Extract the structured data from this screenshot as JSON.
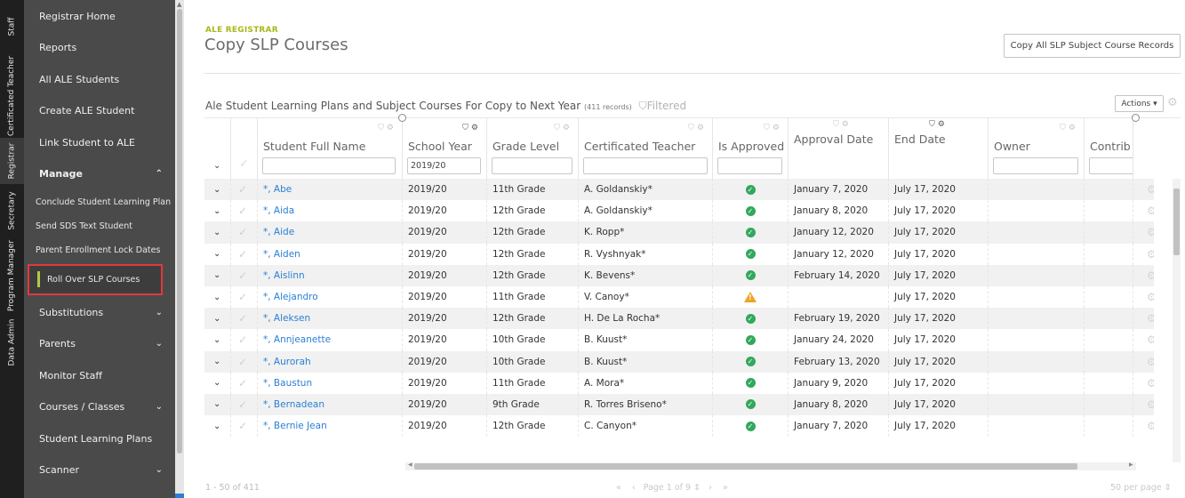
{
  "rail_tabs": [
    "Staff",
    "Certificated Teacher",
    "Registrar",
    "Secretary",
    "Program Manager",
    "Data Admin"
  ],
  "sidebar": {
    "items": [
      {
        "label": "Registrar Home"
      },
      {
        "label": "Reports"
      },
      {
        "label": "All ALE Students"
      },
      {
        "label": "Create ALE Student"
      },
      {
        "label": "Link Student to ALE"
      }
    ],
    "manage": {
      "label": "Manage",
      "subitems": [
        "Conclude Student Learning Plan",
        "Send SDS Text Student",
        "Parent Enrollment Lock Dates",
        "Roll Over SLP Courses"
      ]
    },
    "after": [
      {
        "label": "Substitutions",
        "expandable": true
      },
      {
        "label": "Parents",
        "expandable": true
      },
      {
        "label": "Monitor Staff",
        "expandable": false
      },
      {
        "label": "Courses / Classes",
        "expandable": true
      },
      {
        "label": "Student Learning Plans",
        "expandable": false
      },
      {
        "label": "Scanner",
        "expandable": true
      }
    ]
  },
  "header": {
    "eyebrow": "ALE REGISTRAR",
    "title": "Copy SLP Courses",
    "copy_button": "Copy All SLP Subject Course Records"
  },
  "grid": {
    "title": "Ale Student Learning Plans and Subject Courses For Copy to Next Year",
    "count": "(411 records)",
    "filtered": "Filtered",
    "actions_label": "Actions ▾",
    "columns": {
      "name": "Student Full Name",
      "year": "School Year",
      "grade": "Grade Level",
      "teacher": "Certificated Teacher",
      "approved": "Is Approved",
      "approval_date": "Approval Date",
      "end_date": "End Date",
      "owner": "Owner",
      "contrib": "Contrib"
    },
    "filters": {
      "year": "2019/20"
    },
    "rows": [
      {
        "name": "*, Abe",
        "year": "2019/20",
        "grade": "11th Grade",
        "teacher": "A. Goldanskiy*",
        "approved": "ok",
        "approval_date": "January 7, 2020",
        "end_date": "July 17, 2020"
      },
      {
        "name": "*, Aida",
        "year": "2019/20",
        "grade": "12th Grade",
        "teacher": "A. Goldanskiy*",
        "approved": "ok",
        "approval_date": "January 8, 2020",
        "end_date": "July 17, 2020"
      },
      {
        "name": "*, Aide",
        "year": "2019/20",
        "grade": "12th Grade",
        "teacher": "K. Ropp*",
        "approved": "ok",
        "approval_date": "January 12, 2020",
        "end_date": "July 17, 2020"
      },
      {
        "name": "*, Aiden",
        "year": "2019/20",
        "grade": "12th Grade",
        "teacher": "R. Vyshnyak*",
        "approved": "ok",
        "approval_date": "January 12, 2020",
        "end_date": "July 17, 2020"
      },
      {
        "name": "*, Aislinn",
        "year": "2019/20",
        "grade": "12th Grade",
        "teacher": "K. Bevens*",
        "approved": "ok",
        "approval_date": "February 14, 2020",
        "end_date": "July 17, 2020"
      },
      {
        "name": "*, Alejandro",
        "year": "2019/20",
        "grade": "11th Grade",
        "teacher": "V. Canoy*",
        "approved": "warn",
        "approval_date": "",
        "end_date": "July 17, 2020"
      },
      {
        "name": "*, Aleksen",
        "year": "2019/20",
        "grade": "12th Grade",
        "teacher": "H. De La Rocha*",
        "approved": "ok",
        "approval_date": "February 19, 2020",
        "end_date": "July 17, 2020"
      },
      {
        "name": "*, Annjeanette",
        "year": "2019/20",
        "grade": "10th Grade",
        "teacher": "B. Kuust*",
        "approved": "ok",
        "approval_date": "January 24, 2020",
        "end_date": "July 17, 2020"
      },
      {
        "name": "*, Aurorah",
        "year": "2019/20",
        "grade": "10th Grade",
        "teacher": "B. Kuust*",
        "approved": "ok",
        "approval_date": "February 13, 2020",
        "end_date": "July 17, 2020"
      },
      {
        "name": "*, Baustun",
        "year": "2019/20",
        "grade": "11th Grade",
        "teacher": "A. Mora*",
        "approved": "ok",
        "approval_date": "January 9, 2020",
        "end_date": "July 17, 2020"
      },
      {
        "name": "*, Bernadean",
        "year": "2019/20",
        "grade": "9th Grade",
        "teacher": "R. Torres Briseno*",
        "approved": "ok",
        "approval_date": "January 8, 2020",
        "end_date": "July 17, 2020"
      },
      {
        "name": "*, Bernie Jean",
        "year": "2019/20",
        "grade": "12th Grade",
        "teacher": "C. Canyon*",
        "approved": "ok",
        "approval_date": "January 7, 2020",
        "end_date": "July 17, 2020"
      }
    ]
  },
  "pager": {
    "range": "1 - 50 of 411",
    "page": "Page 1 of 9 ⇕",
    "per_page": "50 per page ⇕"
  },
  "colors": {
    "accent": "#a9b81c",
    "link": "#2a7fd4",
    "sidebar": "#4a4a4a",
    "highlight": "#e03a3a",
    "ok": "#32a85c",
    "warn": "#f0a321"
  }
}
